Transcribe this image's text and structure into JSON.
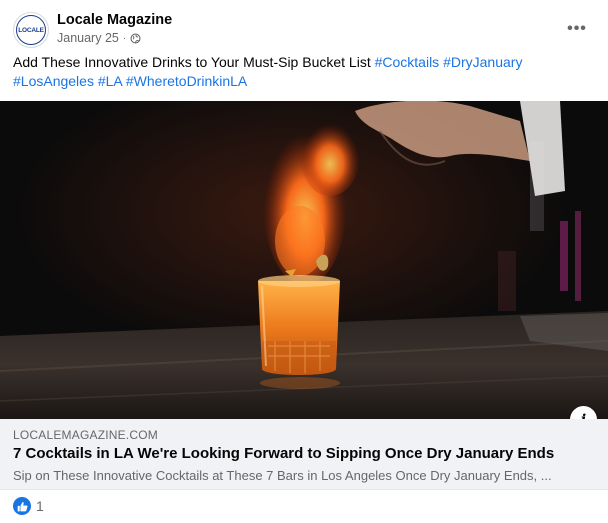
{
  "post": {
    "author": "Locale Magazine",
    "avatar_text": "LOCALE",
    "date": "January 25",
    "separator": "·",
    "privacy_icon": "globe-icon",
    "more_icon": "more-horizontal-icon",
    "more_label": "•••",
    "text_main": "Add These Innovative Drinks to Your Must-Sip Bucket List ",
    "hashtags": [
      "#Cocktails",
      "#DryJanuary",
      "#LosAngeles",
      "#LA",
      "#WheretoDrinkinLA"
    ]
  },
  "link_preview": {
    "domain": "LOCALEMAGAZINE.COM",
    "title": "7 Cocktails in LA We're Looking Forward to Sipping Once Dry January Ends",
    "description": "Sip on These Innovative Cocktails at These 7 Bars in Los Angeles Once Dry January Ends, ...",
    "info_icon": "info-icon",
    "info_label": "i"
  },
  "reactions": {
    "icon": "like-icon",
    "count": "1"
  },
  "colors": {
    "link_blue": "#1b74e4",
    "secondary_text": "#65676b",
    "card_background": "#f0f2f5"
  }
}
